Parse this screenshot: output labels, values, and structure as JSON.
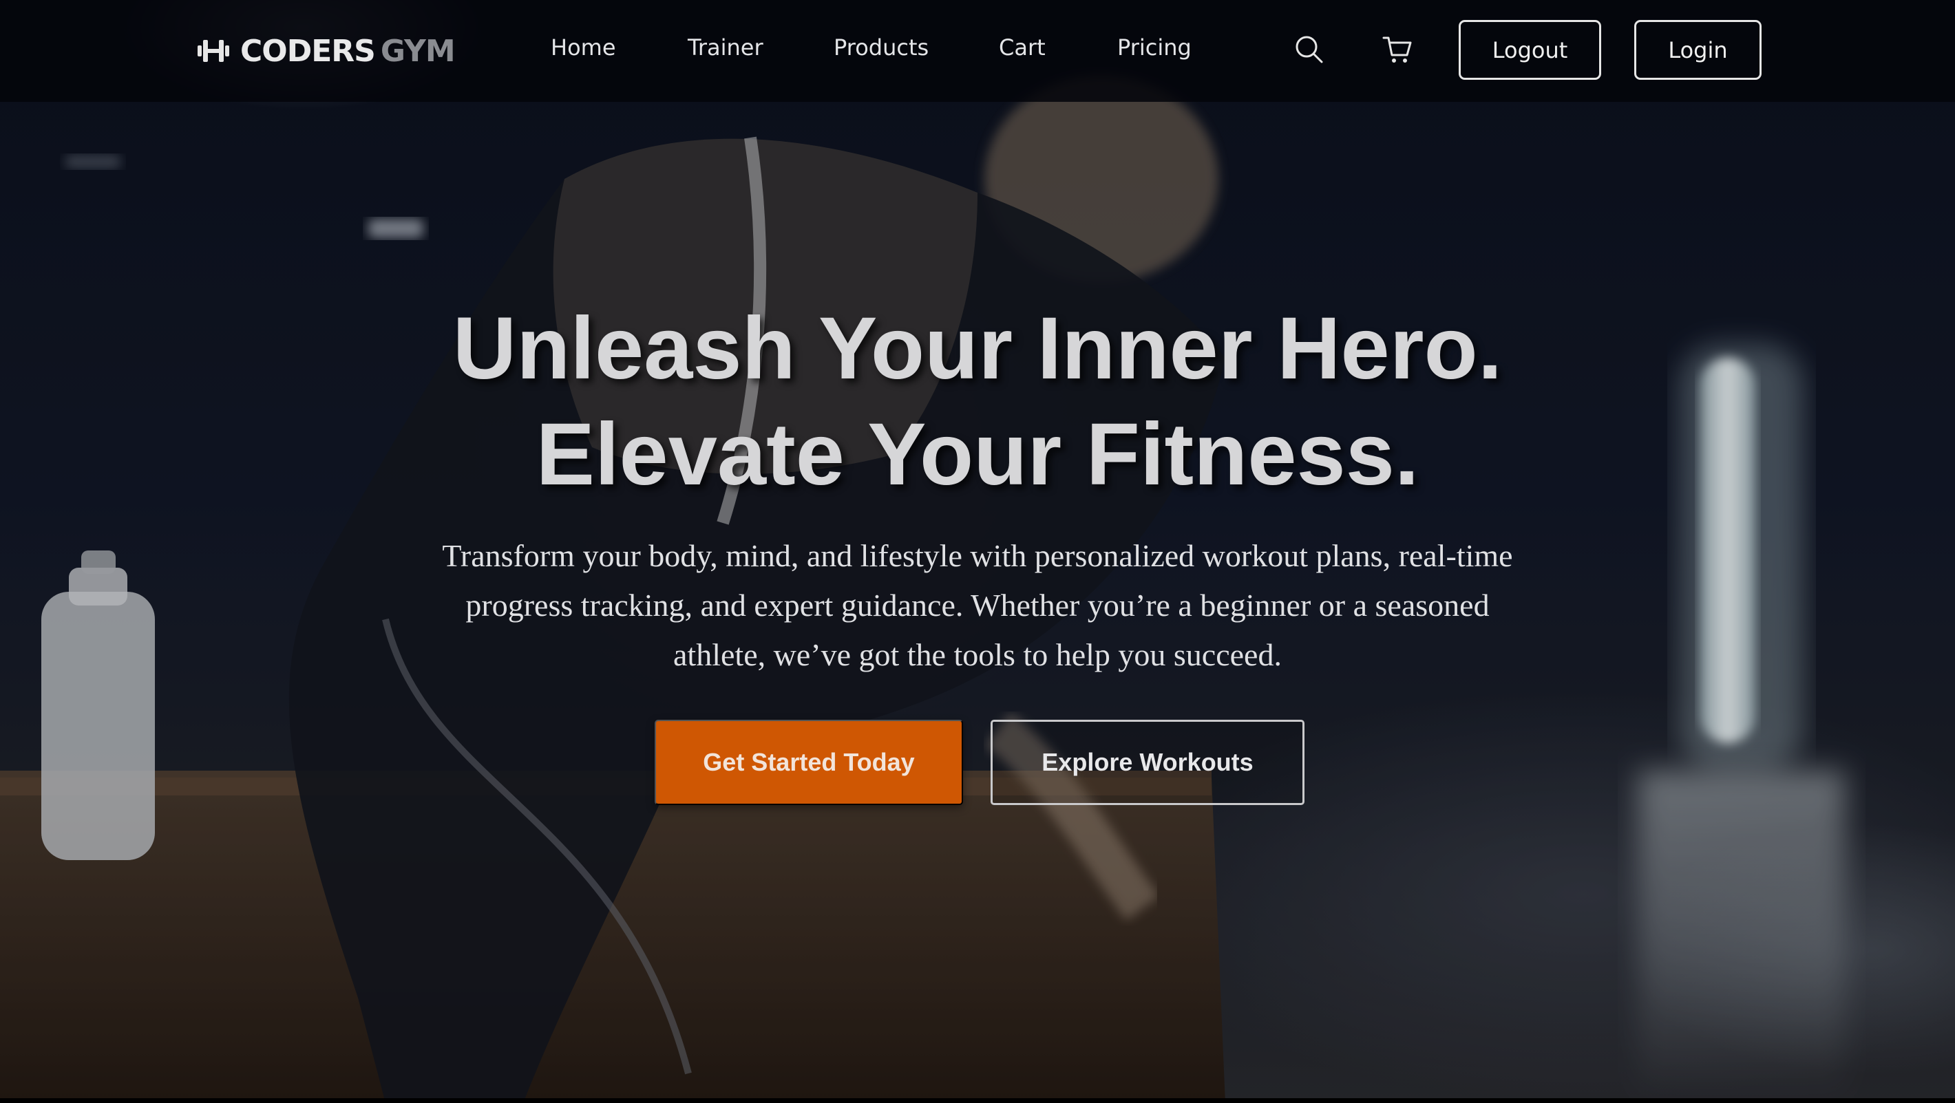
{
  "brand": {
    "name_primary": "CODERS",
    "name_secondary": "GYM",
    "icon": "dumbbell-icon"
  },
  "nav": {
    "links": [
      "Home",
      "Trainer",
      "Products",
      "Cart",
      "Pricing"
    ],
    "search_icon": "search-icon",
    "cart_icon": "shopping-cart-icon",
    "logout_label": "Logout",
    "login_label": "Login"
  },
  "hero": {
    "title_line1": "Unleash Your Inner Hero.",
    "title_line2": "Elevate Your Fitness.",
    "subtitle": "Transform your body, mind, and lifestyle with personalized workout plans, real-time progress tracking, and expert guidance. Whether you’re a beginner or a seasoned athlete, we’ve got the tools to help you succeed.",
    "primary_cta": "Get Started Today",
    "secondary_cta": "Explore Workouts"
  },
  "colors": {
    "accent": "#cf5703",
    "navbar_bg": "#03050a",
    "title_text": "#d6d6d8",
    "body_text": "#e0e1e4"
  }
}
